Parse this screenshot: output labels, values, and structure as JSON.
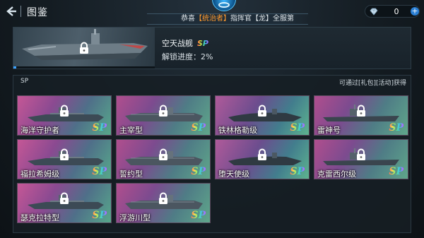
{
  "header": {
    "title": "图鉴",
    "ticker_prefix": "恭喜",
    "ticker_highlight": "【统治者】",
    "ticker_suffix": "指挥官【龙】全服第",
    "currency_value": "0",
    "plus_label": "+"
  },
  "featured": {
    "name": "空天战舰",
    "badge": "SP",
    "progress_label": "解锁进度：",
    "progress_value": "2%",
    "progress_fraction": 0.02
  },
  "collection": {
    "section_label": "SP",
    "obtain_hint": "可通过[礼包][活动]获得",
    "cards": [
      {
        "name": "海洋守护者",
        "badge": "SP",
        "variant": "a"
      },
      {
        "name": "主宰型",
        "badge": "SP",
        "variant": ""
      },
      {
        "name": "铁林格勒级",
        "badge": "SP",
        "variant": "b"
      },
      {
        "name": "雷神号",
        "badge": "SP",
        "variant": ""
      },
      {
        "name": "福拉希姆级",
        "badge": "SP",
        "variant": "a"
      },
      {
        "name": "誓约型",
        "badge": "SP",
        "variant": ""
      },
      {
        "name": "堕天使级",
        "badge": "SP",
        "variant": "b"
      },
      {
        "name": "克雷西尔级",
        "badge": "SP",
        "variant": ""
      },
      {
        "name": "瑟克拉特型",
        "badge": "SP",
        "variant": "a"
      },
      {
        "name": "浮游川型",
        "badge": "SP",
        "variant": ""
      }
    ]
  },
  "colors": {
    "accent": "#3aa2ff",
    "ticker_highlight": "#ff9a2e"
  },
  "icons": [
    "back-arrow-icon",
    "game-logo-icon",
    "diamond-icon",
    "plus-icon",
    "lock-icon"
  ]
}
